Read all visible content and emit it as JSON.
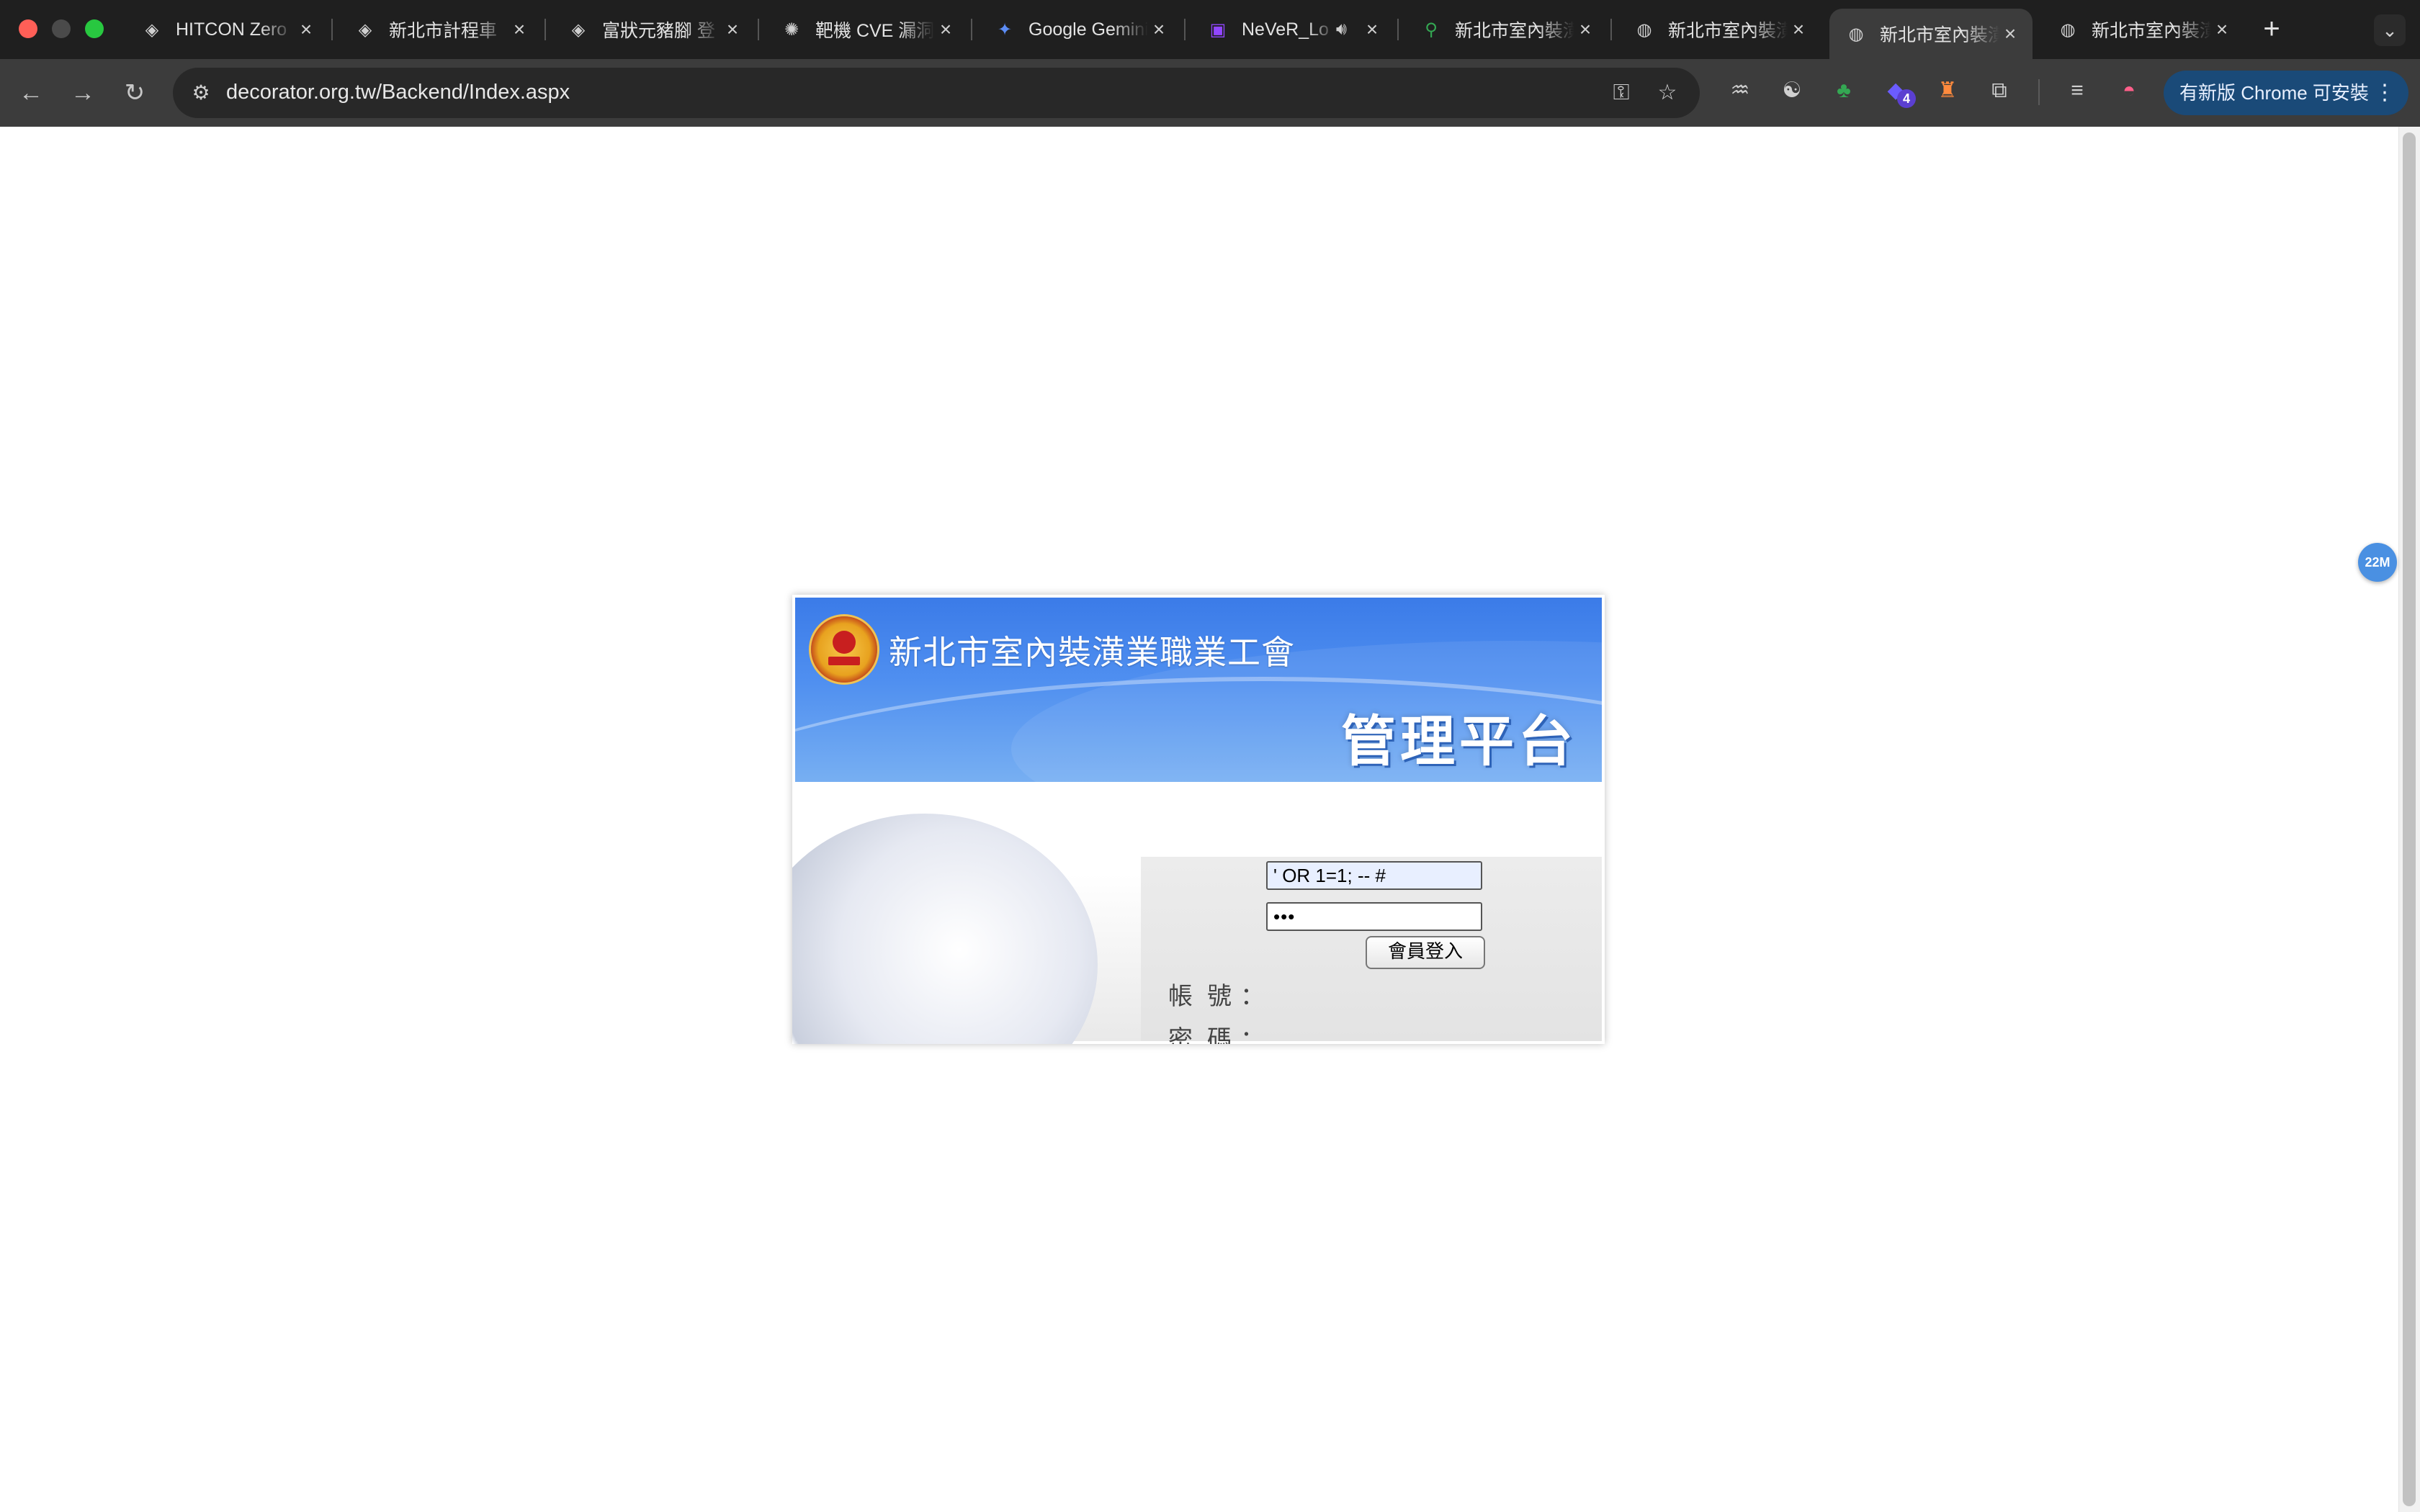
{
  "tabs": [
    {
      "label": "HITCON Zero",
      "favicon": "hitcon-icon"
    },
    {
      "label": "新北市計程車",
      "favicon": "hitcon-icon"
    },
    {
      "label": "富狀元豬腳 登",
      "favicon": "hitcon-icon"
    },
    {
      "label": "靶機 CVE 漏洞",
      "favicon": "openai-icon"
    },
    {
      "label": "Google Gemini",
      "favicon": "gemini-icon"
    },
    {
      "label": "NeVeR_Lo",
      "favicon": "twitch-icon",
      "audio": true
    },
    {
      "label": "新北市室內裝潢",
      "favicon": "maps-pin-icon"
    },
    {
      "label": "新北市室內裝潢",
      "favicon": "globe-icon"
    },
    {
      "label": "新北市室內裝潢",
      "favicon": "globe-icon",
      "active": true
    },
    {
      "label": "新北市室內裝潢",
      "favicon": "globe-icon"
    }
  ],
  "toolbar": {
    "url": "decorator.org.tw/Backend/Index.aspx",
    "update_label": "有新版 Chrome 可安裝"
  },
  "extensions": {
    "badge_count": "4"
  },
  "page": {
    "floating_badge": "22M",
    "union_name": "新北市室內裝潢業職業工會",
    "platform_title": "管理平台",
    "account_label": "帳號",
    "password_label": "密碼",
    "colon": "：",
    "account_value": "' OR 1=1; -- #",
    "password_value": "•••",
    "login_button": "會員登入"
  },
  "colors": {
    "banner_blue": "#3b7be8",
    "update_button": "#1a4a78"
  }
}
